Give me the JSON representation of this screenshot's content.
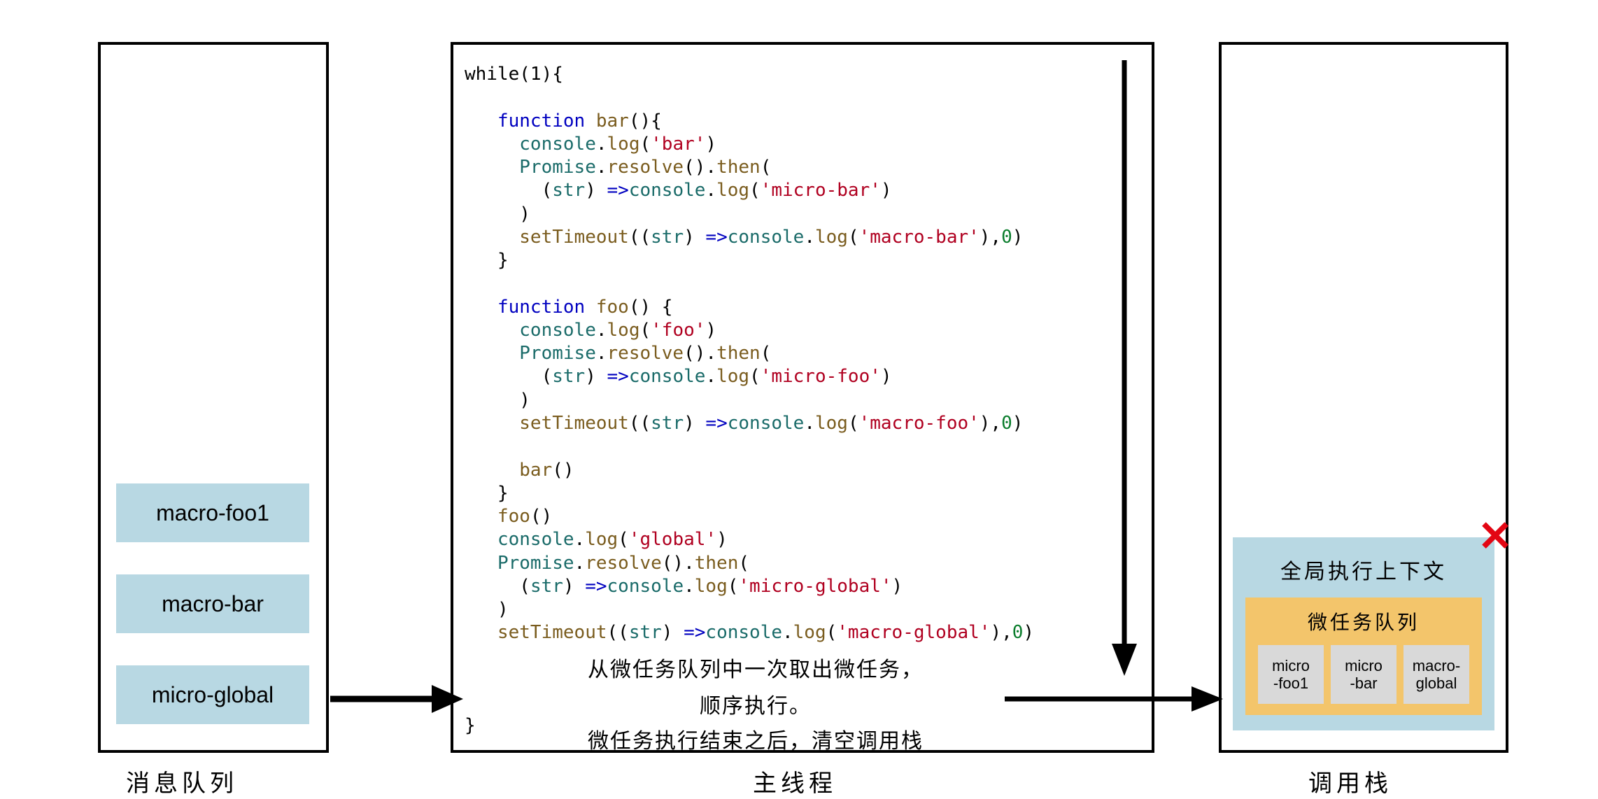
{
  "labels": {
    "queue": "消息队列",
    "main_thread": "主线程",
    "call_stack": "调用栈"
  },
  "message_queue": [
    "macro-foo1",
    "macro-bar",
    "micro-global"
  ],
  "code": {
    "while_open": "while(1){",
    "brace_close": "}",
    "kw_function": "function",
    "name_bar": "bar",
    "name_foo": "foo",
    "obj_console": "console",
    "m_log": "log",
    "obj_promise": "Promise",
    "m_resolve": "resolve",
    "m_then": "then",
    "fn_setTimeout": "setTimeout",
    "param_str": "str",
    "arrow": "=>",
    "lit_bar": "'bar'",
    "lit_micro_bar": "'micro-bar'",
    "lit_macro_bar": "'macro-bar'",
    "lit_foo": "'foo'",
    "lit_micro_foo": "'micro-foo'",
    "lit_macro_foo": "'macro-foo'",
    "lit_global": "'global'",
    "lit_micro_global": "'micro-global'",
    "lit_macro_global": "'macro-global'",
    "zero": "0",
    "call_foo": "foo",
    "call_bar": "bar"
  },
  "callouts": {
    "line1": "从微任务队列中一次取出微任务，",
    "line2": "顺序执行。",
    "line3": "微任务执行结束之后，清空调用栈"
  },
  "context": {
    "title": "全局执行上下文",
    "microtask_title": "微任务队列",
    "items": [
      "micro\n-foo1",
      "micro\n-bar",
      "macro-\nglobal"
    ]
  },
  "icons": {
    "close": "✕"
  }
}
